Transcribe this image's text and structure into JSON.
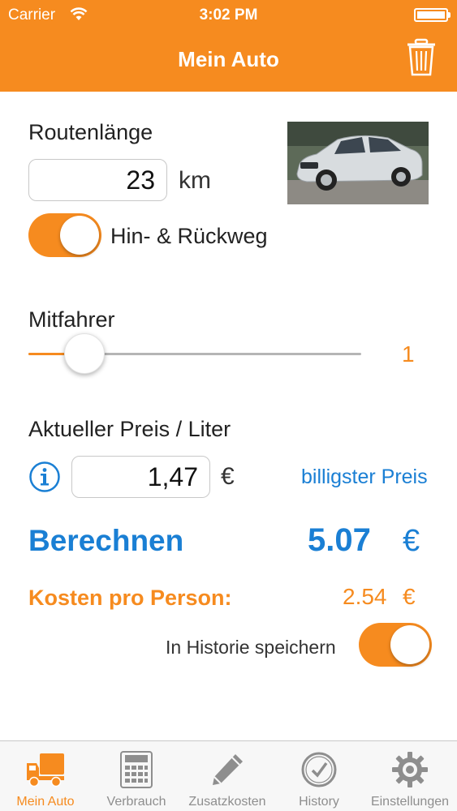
{
  "status_bar": {
    "carrier": "Carrier",
    "time": "3:02 PM"
  },
  "nav": {
    "title": "Mein Auto",
    "delete_icon": "trash-icon"
  },
  "route": {
    "label": "Routenlänge",
    "value": "23",
    "unit": "km"
  },
  "round_trip": {
    "label": "Hin- & Rückweg",
    "enabled": true
  },
  "car_photo": {
    "description_icon": "car-photo"
  },
  "passengers": {
    "label": "Mitfahrer",
    "value": "1",
    "slider_fraction": 0.17
  },
  "price": {
    "label": "Aktueller Preis / Liter",
    "value": "1,47",
    "unit": "€",
    "cheapest_link": "billigster Preis",
    "info_icon": "info-icon"
  },
  "calculate": {
    "button_label": "Berechnen",
    "result": "5.07",
    "currency": "€"
  },
  "per_person": {
    "label": "Kosten pro Person:",
    "value": "2.54",
    "currency": "€"
  },
  "save_history": {
    "label": "In Historie speichern",
    "enabled": true
  },
  "tabs": [
    {
      "label": "Mein Auto",
      "icon": "truck-icon",
      "active": true
    },
    {
      "label": "Verbrauch",
      "icon": "calculator-icon",
      "active": false
    },
    {
      "label": "Zusatzkosten",
      "icon": "pencil-icon",
      "active": false
    },
    {
      "label": "History",
      "icon": "clock-icon",
      "active": false
    },
    {
      "label": "Einstellungen",
      "icon": "gear-icon",
      "active": false
    }
  ],
  "colors": {
    "accent": "#f68b1f",
    "link": "#1a7fd4",
    "tab_inactive": "#8e8e8e"
  }
}
